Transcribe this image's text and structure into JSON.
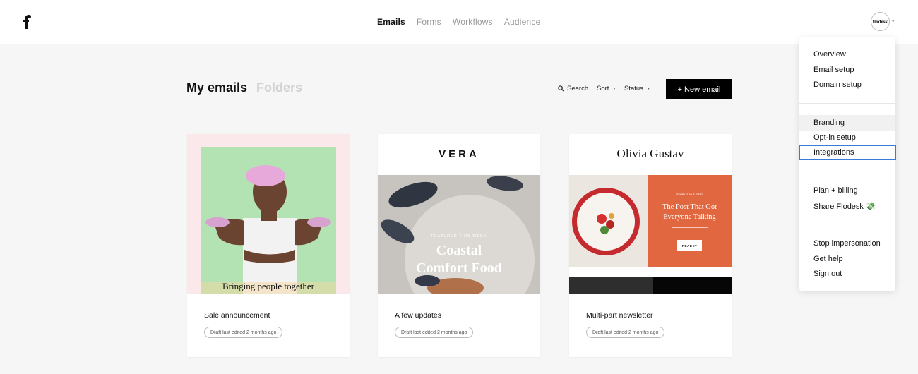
{
  "nav": {
    "tabs": [
      "Emails",
      "Forms",
      "Workflows",
      "Audience"
    ],
    "active": "Emails"
  },
  "account": {
    "avatar_text": "flodesk"
  },
  "heading": {
    "tab_my": "My emails",
    "tab_folders": "Folders"
  },
  "toolbar": {
    "search": "Search",
    "sort": "Sort",
    "status": "Status",
    "new_email": "+ New email"
  },
  "cards": [
    {
      "title": "Sale announcement",
      "status": "Draft last edited 2 months ago",
      "thumb_caption": "Bringing people together"
    },
    {
      "title": "A few updates",
      "status": "Draft last edited 2 months ago",
      "thumb_brand": "VERA",
      "thumb_featured": "FEATURED THIS WEEK",
      "thumb_headline_1": "Coastal",
      "thumb_headline_2": "Comfort Food"
    },
    {
      "title": "Multi-part newsletter",
      "status": "Draft last edited 2 months ago",
      "thumb_brand": "Olivia Gustav",
      "thumb_small": "From The 'Gram",
      "thumb_headline_1": "The Post That Got",
      "thumb_headline_2": "Everyone Talking",
      "thumb_button": "READ IT"
    }
  ],
  "menu": {
    "group1": [
      "Overview",
      "Email setup",
      "Domain setup"
    ],
    "group2": [
      "Branding",
      "Opt-in setup",
      "Integrations"
    ],
    "group3": [
      "Plan + billing",
      "Share Flodesk 💸"
    ],
    "group4": [
      "Stop impersonation",
      "Get help",
      "Sign out"
    ],
    "hovered": "Branding",
    "focused": "Integrations"
  },
  "colors": {
    "primary_button": "#000000",
    "focus_outline": "#3a7bd5",
    "card1_bg": "#fbe8ea",
    "card1_photo_bg": "#b3e3b3",
    "card3_orange": "#e0673f"
  }
}
